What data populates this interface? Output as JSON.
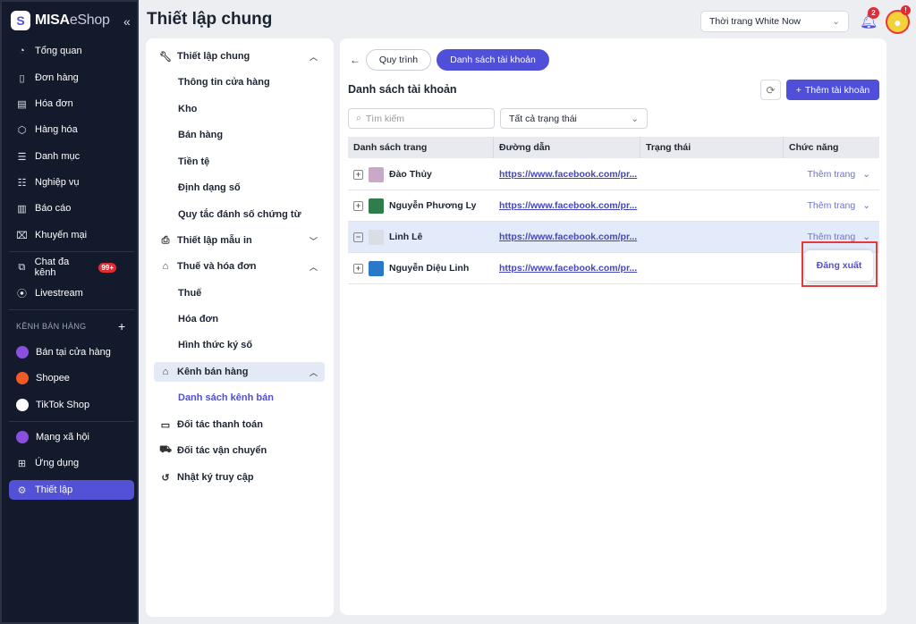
{
  "brand": {
    "name": "MISA",
    "suffix": "eShop"
  },
  "sidebar": {
    "items": [
      {
        "label": "Tổng quan",
        "icon": "gauge-icon"
      },
      {
        "label": "Đơn hàng",
        "icon": "order-icon"
      },
      {
        "label": "Hóa đơn",
        "icon": "invoice-icon"
      },
      {
        "label": "Hàng hóa",
        "icon": "box-icon"
      },
      {
        "label": "Danh mục",
        "icon": "list-icon"
      },
      {
        "label": "Nghiệp vụ",
        "icon": "tasks-icon"
      },
      {
        "label": "Báo cáo",
        "icon": "chart-icon"
      },
      {
        "label": "Khuyến mại",
        "icon": "gift-icon"
      }
    ],
    "chat": {
      "label": "Chat đa kênh",
      "badge": "99+"
    },
    "livestream": "Livestream",
    "section_title": "KÊNH BÁN HÀNG",
    "channels": [
      {
        "label": "Bán tại cửa hàng",
        "color": "#8a4fe0"
      },
      {
        "label": "Shopee",
        "color": "#f05a24"
      },
      {
        "label": "TikTok Shop",
        "color": "#ffffff"
      }
    ],
    "bottom": [
      {
        "label": "Mạng xã hội"
      },
      {
        "label": "Ứng dụng"
      },
      {
        "label": "Thiết lập",
        "active": true
      }
    ]
  },
  "header": {
    "title": "Thiết lập chung",
    "store": "Thời trang White Now",
    "notifications": "2",
    "avatar_badge": "!"
  },
  "settings_menu": {
    "general": "Thiết lập chung",
    "general_items": [
      "Thông tin cửa hàng",
      "Kho",
      "Bán hàng",
      "Tiền tệ",
      "Định dạng số",
      "Quy tắc đánh số chứng từ"
    ],
    "print": "Thiết lập mẫu in",
    "tax": "Thuế và hóa đơn",
    "tax_items": [
      "Thuế",
      "Hóa đơn",
      "Hình thức ký số"
    ],
    "channels": "Kênh bán hàng",
    "channels_items": [
      "Danh sách kênh bán"
    ],
    "payment": "Đối tác thanh toán",
    "shipping": "Đối tác vận chuyển",
    "log": "Nhật ký truy cập"
  },
  "main": {
    "tabs": [
      "Quy trình",
      "Danh sách tài khoản"
    ],
    "title": "Danh sách tài khoản",
    "add_button": "Thêm tài khoản",
    "search_placeholder": "Tìm kiếm",
    "status_filter": "Tất cả trạng thái",
    "columns": [
      "Danh sách trang",
      "Đường dẫn",
      "Trạng thái",
      "Chức năng"
    ],
    "rows": [
      {
        "name": "Đào Thủy",
        "link": "https://www.facebook.com/pr...",
        "status": "",
        "action": "Thêm trang",
        "expanded": false
      },
      {
        "name": "Nguyễn Phương Ly",
        "link": "https://www.facebook.com/pr...",
        "status": "",
        "action": "Thêm trang",
        "expanded": false
      },
      {
        "name": "Linh Lê",
        "link": "https://www.facebook.com/pr...",
        "status": "",
        "action": "Thêm trang",
        "expanded": true
      },
      {
        "name": "Nguyễn Diệu Linh",
        "link": "https://www.facebook.com/pr...",
        "status": "",
        "action": "",
        "expanded": false
      }
    ],
    "popup_item": "Đăng xuất"
  },
  "colors": {
    "accent": "#4f4fd9",
    "sidebar_bg": "#131a2b",
    "highlight": "#e33b3b"
  }
}
